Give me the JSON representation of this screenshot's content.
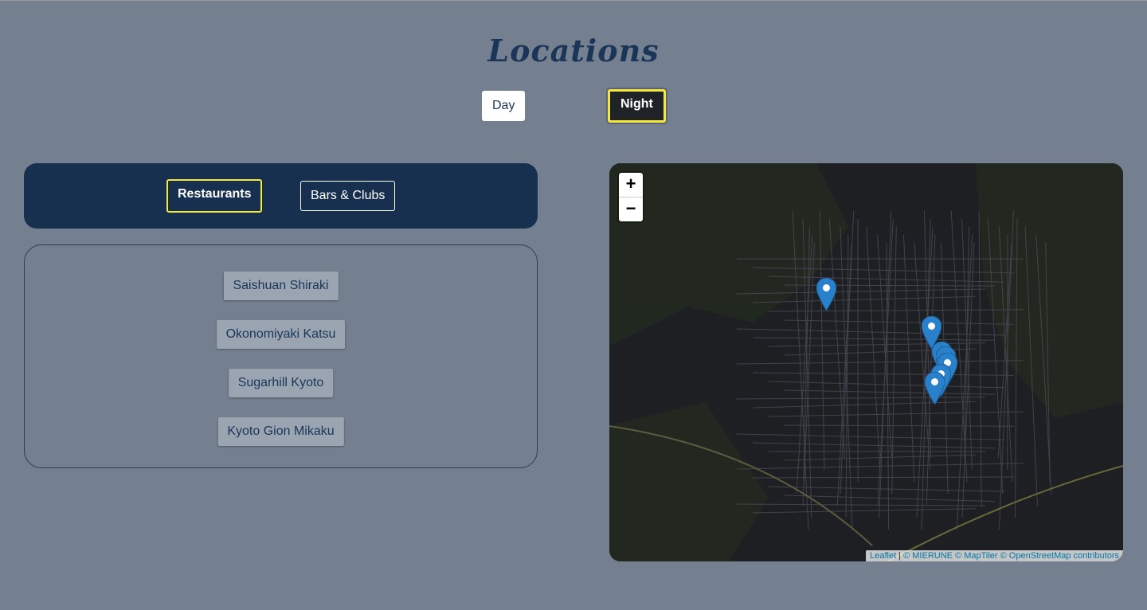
{
  "header": {
    "title": "Locations"
  },
  "mode": {
    "day_label": "Day",
    "night_label": "Night",
    "selected": "Night"
  },
  "categories": {
    "items": [
      {
        "label": "Restaurants",
        "selected": true
      },
      {
        "label": "Bars & Clubs",
        "selected": false
      }
    ]
  },
  "locations": [
    {
      "label": "Saishuan Shiraki"
    },
    {
      "label": "Okonomiyaki Katsu"
    },
    {
      "label": "Sugarhill Kyoto"
    },
    {
      "label": "Kyoto Gion Mikaku"
    }
  ],
  "map": {
    "zoom_in": "+",
    "zoom_out": "−",
    "attribution": {
      "leaflet": "Leaflet",
      "sep": " | ",
      "credits": "© MIERUNE © MapTiler © OpenStreetMap contributors"
    },
    "marker_color": "#2a81cb",
    "marker_icon": "map-pin-icon",
    "accent": "#f5e83a"
  }
}
